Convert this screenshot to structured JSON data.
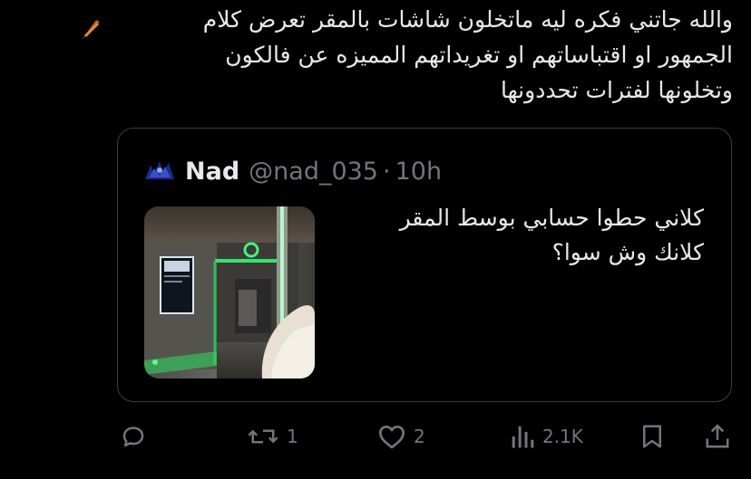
{
  "tweet": {
    "lines": [
      "والله جاتني فكره ليه ماتخلون شاشات  بالمقر تعرض كلام",
      "الجمهور او اقتباساتهم او تغريداتهم المميزه عن فالكون",
      "وتخلونها لفترات تحددونها"
    ]
  },
  "quoted": {
    "name": "Nad",
    "handle": "@nad_035",
    "separator": "·",
    "time": "10h",
    "lines": [
      "كلاني حطوا حسابي بوسط المقر",
      "كلانك وش سوا؟"
    ]
  },
  "actions": {
    "reply_icon": "reply-bubble-icon",
    "retweet_icon": "retweet-icon",
    "retweet_count": "1",
    "like_icon": "heart-icon",
    "like_count": "2",
    "views_icon": "views-bar-chart-icon",
    "views_count": "2.1K",
    "bookmark_icon": "bookmark-icon",
    "share_icon": "share-upload-icon"
  },
  "colors": {
    "background": "#000000",
    "text": "#e7e9ea",
    "muted": "#71767b",
    "border": "#3a3d41"
  }
}
